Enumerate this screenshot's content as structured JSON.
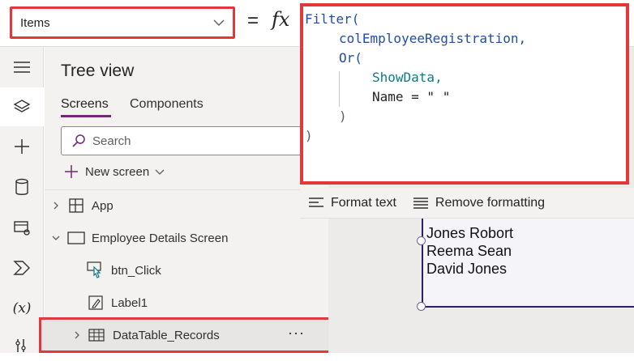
{
  "formula_bar": {
    "property": "Items",
    "equals": "=",
    "fx": "fx"
  },
  "formula": {
    "lines": [
      "Filter(",
      "colEmployeeRegistration,",
      "Or(",
      "ShowData,",
      "Name = \" \"",
      ")",
      ")"
    ]
  },
  "tree_view": {
    "title": "Tree view",
    "tabs": [
      "Screens",
      "Components"
    ],
    "search_placeholder": "Search",
    "new_screen": "New screen",
    "items": [
      {
        "label": "App"
      },
      {
        "label": "Employee Details Screen"
      },
      {
        "label": "btn_Click"
      },
      {
        "label": "Label1"
      },
      {
        "label": "DataTable_Records",
        "more": "···"
      }
    ]
  },
  "format_toolbar": {
    "format_text": "Format text",
    "remove_formatting": "Remove formatting"
  },
  "canvas": {
    "names": [
      "Jones Robort",
      "Reema Sean",
      "David Jones"
    ]
  },
  "colors": {
    "highlight": "#e4373b",
    "accent": "#742774",
    "keyword": "#1f4ea3",
    "field": "#0f7a87"
  }
}
